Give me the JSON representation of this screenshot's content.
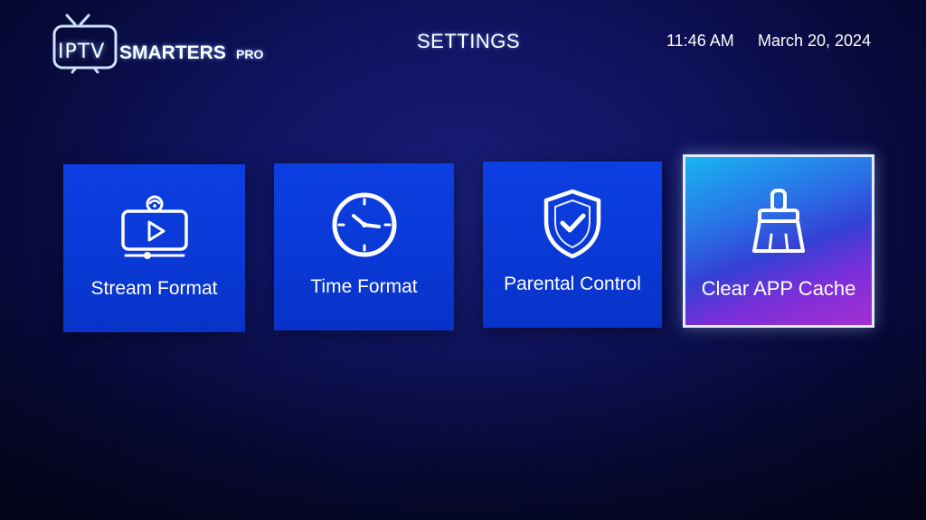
{
  "header": {
    "logo": {
      "iptv": "IPTV",
      "smarters": "SMARTERS",
      "pro": "PRO"
    },
    "title": "SETTINGS",
    "time": "11:46 AM",
    "date": "March 20, 2024"
  },
  "tiles": [
    {
      "label": "Stream Format",
      "icon": "stream-video-icon"
    },
    {
      "label": "Time Format",
      "icon": "clock-icon"
    },
    {
      "label": "Parental Control",
      "icon": "shield-check-icon"
    },
    {
      "label": "Clear APP Cache",
      "icon": "broom-icon",
      "selected": true
    }
  ],
  "colors": {
    "background": "#0b0f55",
    "tile": "#0a3ad6",
    "selected_gradient_start": "#19b4f2",
    "selected_gradient_end": "#a32fd2",
    "selected_border": "#e6ecff"
  }
}
